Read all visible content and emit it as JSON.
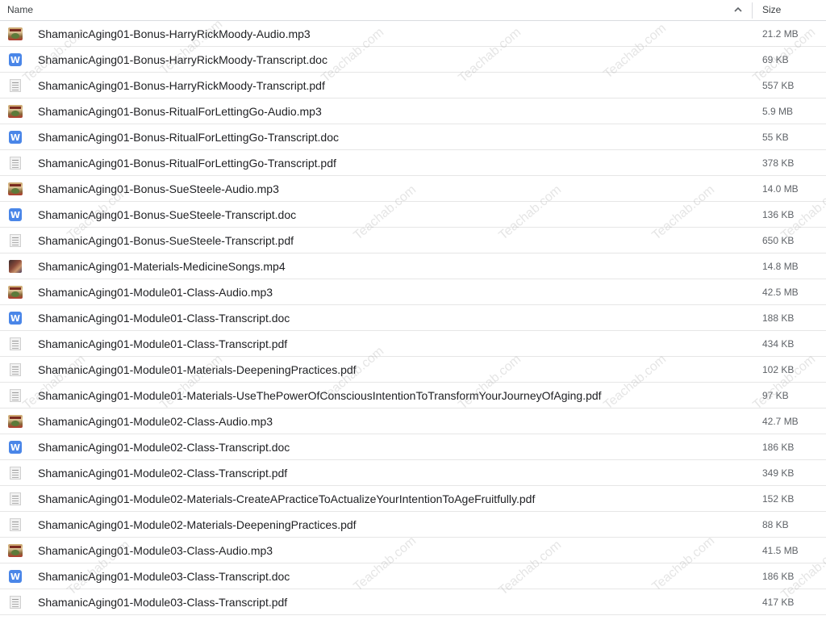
{
  "header": {
    "name_label": "Name",
    "size_label": "Size",
    "sort_icon": "arrow-up-icon"
  },
  "watermark_text": "Teachab.com",
  "icons": {
    "audio": "audio-thumbnail-icon",
    "doc": "word-doc-icon",
    "doc_letter": "W",
    "pdf": "pdf-document-icon",
    "video": "video-thumbnail-icon"
  },
  "colors": {
    "doc_icon": "#4a86e8",
    "row_border": "#e6e6e6",
    "text": "#202124",
    "size_text": "#5f6368"
  },
  "files": [
    {
      "name": "ShamanicAging01-Bonus-HarryRickMoody-Audio.mp3",
      "size": "21.2 MB",
      "type": "audio"
    },
    {
      "name": "ShamanicAging01-Bonus-HarryRickMoody-Transcript.doc",
      "size": "69 KB",
      "type": "doc"
    },
    {
      "name": "ShamanicAging01-Bonus-HarryRickMoody-Transcript.pdf",
      "size": "557 KB",
      "type": "pdf"
    },
    {
      "name": "ShamanicAging01-Bonus-RitualForLettingGo-Audio.mp3",
      "size": "5.9 MB",
      "type": "audio"
    },
    {
      "name": "ShamanicAging01-Bonus-RitualForLettingGo-Transcript.doc",
      "size": "55 KB",
      "type": "doc"
    },
    {
      "name": "ShamanicAging01-Bonus-RitualForLettingGo-Transcript.pdf",
      "size": "378 KB",
      "type": "pdf"
    },
    {
      "name": "ShamanicAging01-Bonus-SueSteele-Audio.mp3",
      "size": "14.0 MB",
      "type": "audio"
    },
    {
      "name": "ShamanicAging01-Bonus-SueSteele-Transcript.doc",
      "size": "136 KB",
      "type": "doc"
    },
    {
      "name": "ShamanicAging01-Bonus-SueSteele-Transcript.pdf",
      "size": "650 KB",
      "type": "pdf"
    },
    {
      "name": "ShamanicAging01-Materials-MedicineSongs.mp4",
      "size": "14.8 MB",
      "type": "video"
    },
    {
      "name": "ShamanicAging01-Module01-Class-Audio.mp3",
      "size": "42.5 MB",
      "type": "audio"
    },
    {
      "name": "ShamanicAging01-Module01-Class-Transcript.doc",
      "size": "188 KB",
      "type": "doc"
    },
    {
      "name": "ShamanicAging01-Module01-Class-Transcript.pdf",
      "size": "434 KB",
      "type": "pdf"
    },
    {
      "name": "ShamanicAging01-Module01-Materials-DeepeningPractices.pdf",
      "size": "102 KB",
      "type": "pdf"
    },
    {
      "name": "ShamanicAging01-Module01-Materials-UseThePowerOfConsciousIntentionToTransformYourJourneyOfAging.pdf",
      "size": "97 KB",
      "type": "pdf"
    },
    {
      "name": "ShamanicAging01-Module02-Class-Audio.mp3",
      "size": "42.7 MB",
      "type": "audio"
    },
    {
      "name": "ShamanicAging01-Module02-Class-Transcript.doc",
      "size": "186 KB",
      "type": "doc"
    },
    {
      "name": "ShamanicAging01-Module02-Class-Transcript.pdf",
      "size": "349 KB",
      "type": "pdf"
    },
    {
      "name": "ShamanicAging01-Module02-Materials-CreateAPracticeToActualizeYourIntentionToAgeFruitfully.pdf",
      "size": "152 KB",
      "type": "pdf"
    },
    {
      "name": "ShamanicAging01-Module02-Materials-DeepeningPractices.pdf",
      "size": "88 KB",
      "type": "pdf"
    },
    {
      "name": "ShamanicAging01-Module03-Class-Audio.mp3",
      "size": "41.5 MB",
      "type": "audio"
    },
    {
      "name": "ShamanicAging01-Module03-Class-Transcript.doc",
      "size": "186 KB",
      "type": "doc"
    },
    {
      "name": "ShamanicAging01-Module03-Class-Transcript.pdf",
      "size": "417 KB",
      "type": "pdf"
    }
  ]
}
